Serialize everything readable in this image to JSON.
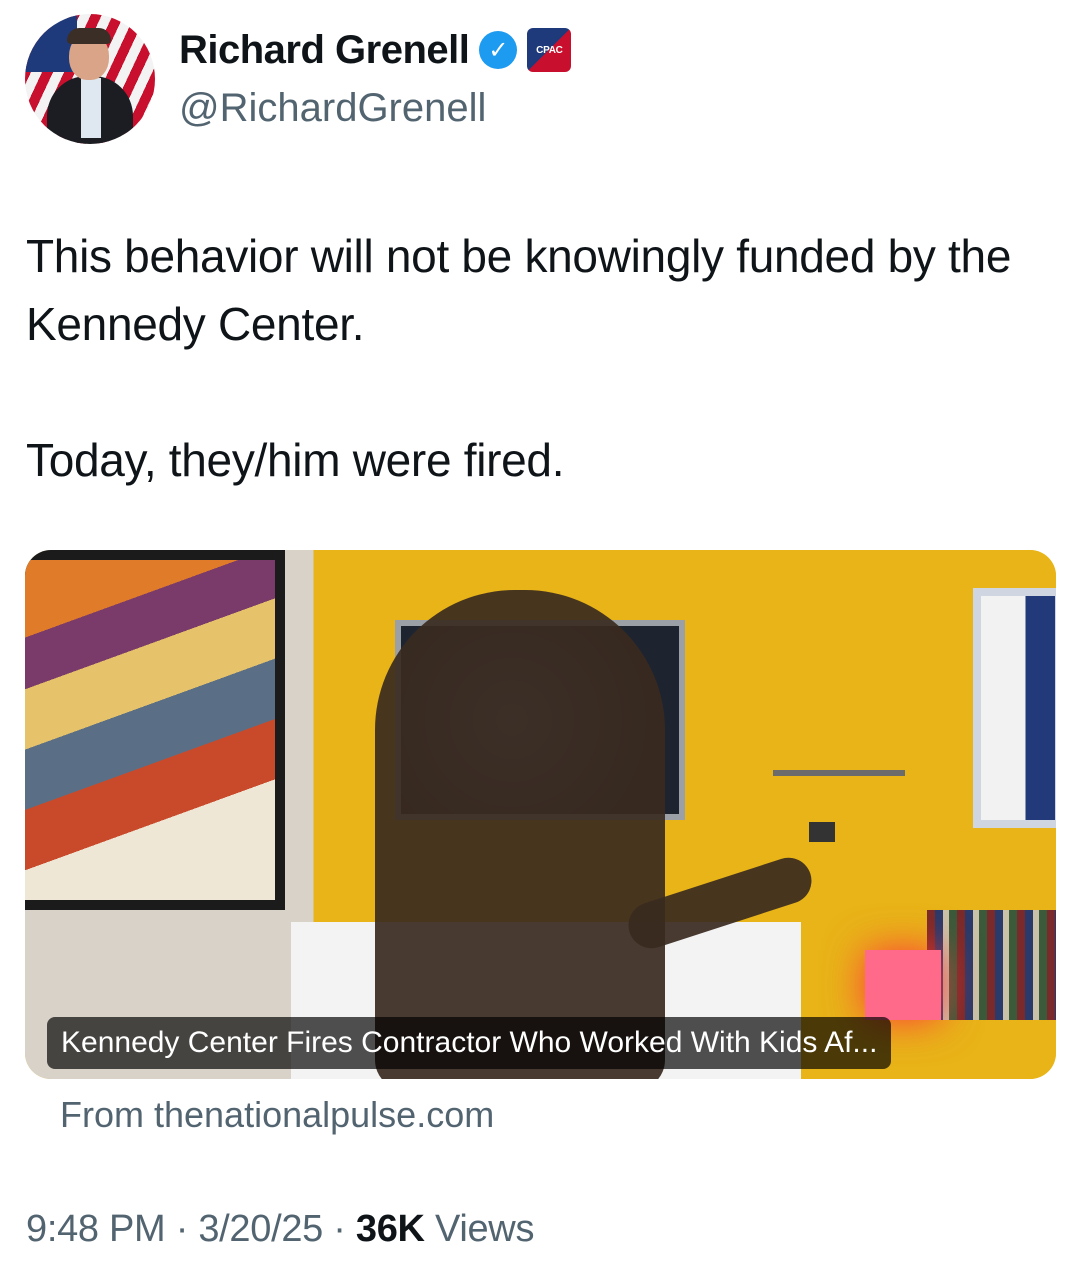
{
  "author": {
    "name": "Richard Grenell",
    "handle": "@RichardGrenell",
    "affiliation_badge": "CPAC",
    "verified_icon": "verified-checkmark-icon"
  },
  "tweet": {
    "text": "This behavior will not be knowingly funded by the Kennedy Center.\n\nToday, they/him were fired."
  },
  "link_card": {
    "caption": "Kennedy Center Fires Contractor Who Worked With Kids Af...",
    "source": "From thenationalpulse.com"
  },
  "meta": {
    "time": "9:48 PM",
    "date": "3/20/25",
    "views_count": "36K",
    "views_label": "Views"
  },
  "colors": {
    "verified": "#1d9bf0",
    "secondary_text": "#536471",
    "primary_text": "#0f1419"
  }
}
